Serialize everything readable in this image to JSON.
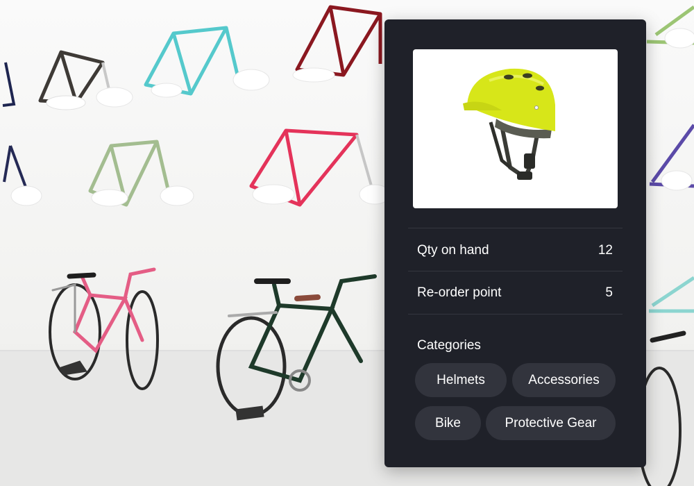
{
  "product": {
    "image_icon": "bike-helmet-image",
    "helmet_color": "#d7e619"
  },
  "inventory": {
    "qty_label": "Qty on hand",
    "qty_value": "12",
    "reorder_label": "Re-order point",
    "reorder_value": "5"
  },
  "categories": {
    "title": "Categories",
    "chips": [
      "Helmets",
      "Accessories",
      "Bike",
      "Protective Gear"
    ]
  },
  "colors": {
    "panel_bg": "#1f2129",
    "chip_bg": "#32343d",
    "text": "#ffffff"
  }
}
